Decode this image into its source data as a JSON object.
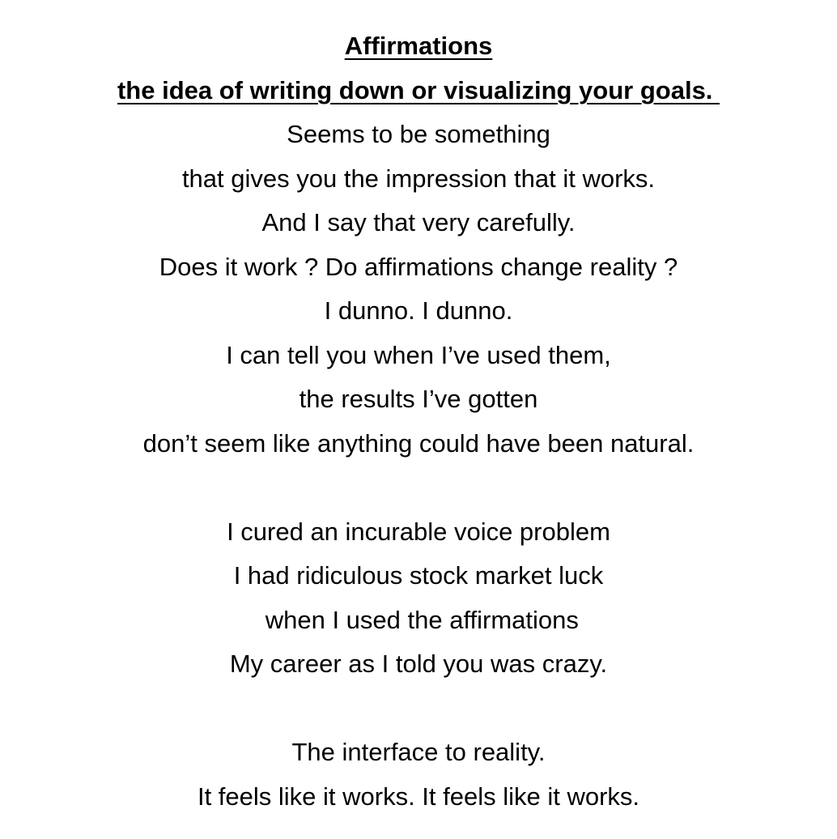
{
  "document": {
    "title": "Affirmations",
    "subtitle": "the idea of writing down or visualizing your goals. ",
    "stanza1": [
      "Seems to be something",
      "that gives you the impression that it works.",
      "And I say that very carefully.",
      "Does it work ? Do affirmations change reality ?",
      "I dunno. I dunno.",
      "I can tell you when I’ve used them,",
      "the results I’ve gotten",
      "don’t seem like anything could have been natural."
    ],
    "stanza2": [
      "I cured an incurable voice problem",
      "I had ridiculous stock market luck",
      " when I used the affirmations",
      "My career as I told you was crazy."
    ],
    "stanza3": [
      "The interface to reality.",
      "It feels like it works. It feels like it works."
    ]
  }
}
